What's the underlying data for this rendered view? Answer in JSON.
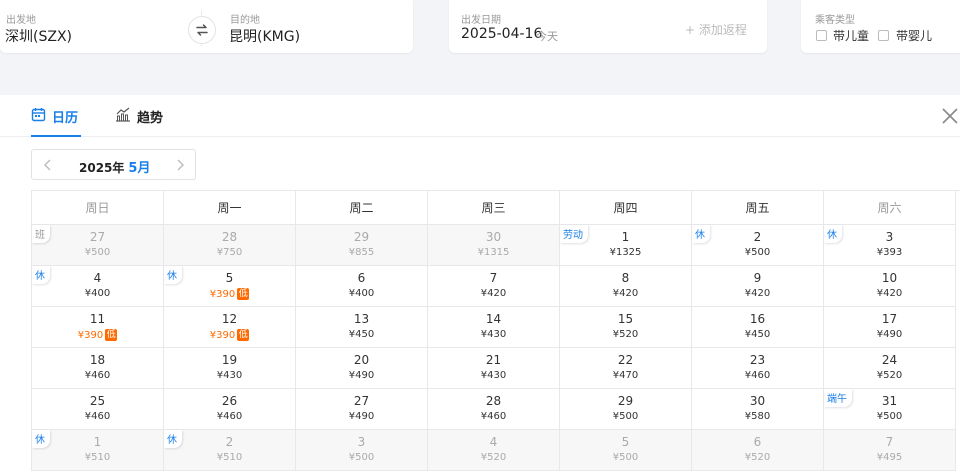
{
  "search": {
    "from_label": "出发地",
    "from_value": "深圳(SZX)",
    "to_label": "目的地",
    "to_value": "昆明(KMG)",
    "date_label": "出发日期",
    "date_value": "2025-04-16",
    "date_hint": "今天",
    "add_return": "+ 添加返程",
    "pax_label": "乘客类型",
    "pax_child": "带儿童",
    "pax_infant": "带婴儿"
  },
  "tabs": {
    "calendar": "日历",
    "trend": "趋势"
  },
  "month_nav": {
    "year": "2025年",
    "month": "5月"
  },
  "weekdays": [
    "周日",
    "周一",
    "周二",
    "周三",
    "周四",
    "周五",
    "周六"
  ],
  "low_label": "低",
  "weeks": [
    [
      {
        "day": "27",
        "price": "¥500",
        "other": true,
        "tag": "班",
        "tag_type": "work"
      },
      {
        "day": "28",
        "price": "¥750",
        "other": true
      },
      {
        "day": "29",
        "price": "¥855",
        "other": true
      },
      {
        "day": "30",
        "price": "¥1315",
        "other": true
      },
      {
        "day": "1",
        "price": "¥1325",
        "tag": "劳动"
      },
      {
        "day": "2",
        "price": "¥500",
        "tag": "休"
      },
      {
        "day": "3",
        "price": "¥393",
        "tag": "休"
      }
    ],
    [
      {
        "day": "4",
        "price": "¥400",
        "tag": "休"
      },
      {
        "day": "5",
        "price": "¥390",
        "low": true,
        "tag": "休"
      },
      {
        "day": "6",
        "price": "¥400"
      },
      {
        "day": "7",
        "price": "¥420"
      },
      {
        "day": "8",
        "price": "¥420"
      },
      {
        "day": "9",
        "price": "¥420"
      },
      {
        "day": "10",
        "price": "¥420"
      }
    ],
    [
      {
        "day": "11",
        "price": "¥390",
        "low": true
      },
      {
        "day": "12",
        "price": "¥390",
        "low": true
      },
      {
        "day": "13",
        "price": "¥450"
      },
      {
        "day": "14",
        "price": "¥430"
      },
      {
        "day": "15",
        "price": "¥520"
      },
      {
        "day": "16",
        "price": "¥450"
      },
      {
        "day": "17",
        "price": "¥490"
      }
    ],
    [
      {
        "day": "18",
        "price": "¥460"
      },
      {
        "day": "19",
        "price": "¥430"
      },
      {
        "day": "20",
        "price": "¥490"
      },
      {
        "day": "21",
        "price": "¥430"
      },
      {
        "day": "22",
        "price": "¥470"
      },
      {
        "day": "23",
        "price": "¥460"
      },
      {
        "day": "24",
        "price": "¥520"
      }
    ],
    [
      {
        "day": "25",
        "price": "¥460"
      },
      {
        "day": "26",
        "price": "¥460"
      },
      {
        "day": "27",
        "price": "¥490"
      },
      {
        "day": "28",
        "price": "¥460"
      },
      {
        "day": "29",
        "price": "¥500"
      },
      {
        "day": "30",
        "price": "¥580"
      },
      {
        "day": "31",
        "price": "¥500",
        "tag": "端午"
      }
    ],
    [
      {
        "day": "1",
        "price": "¥510",
        "other": true,
        "tag": "休"
      },
      {
        "day": "2",
        "price": "¥510",
        "other": true,
        "tag": "休"
      },
      {
        "day": "3",
        "price": "¥500",
        "other": true
      },
      {
        "day": "4",
        "price": "¥520",
        "other": true
      },
      {
        "day": "5",
        "price": "¥500",
        "other": true
      },
      {
        "day": "6",
        "price": "¥520",
        "other": true
      },
      {
        "day": "7",
        "price": "¥495",
        "other": true
      }
    ]
  ],
  "colors": {
    "accent": "#1a7fe8",
    "low_price": "#ff6a00"
  }
}
